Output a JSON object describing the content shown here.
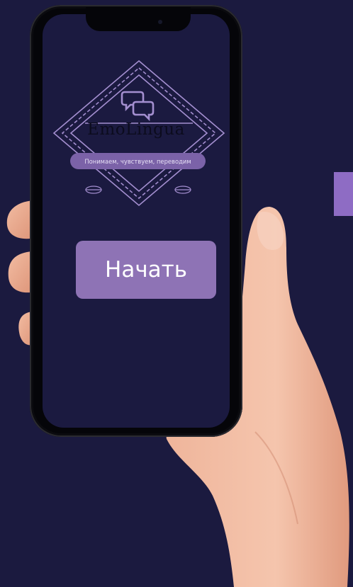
{
  "app": {
    "brand_name": "EmoLingua",
    "tagline": "Понимаем, чувствуем, переводим",
    "logo_icon": "chat-bubbles-icon",
    "leaf_icon": "leaf-icon"
  },
  "main": {
    "start_button_label": "Начать"
  },
  "colors": {
    "background": "#1b1a3f",
    "screen_background": "#1b1a40",
    "accent_purple": "#8e73b5",
    "tagline_pill": "#7b62a8",
    "logo_outline": "#a48fd0",
    "side_accent": "#8e6cc4"
  }
}
